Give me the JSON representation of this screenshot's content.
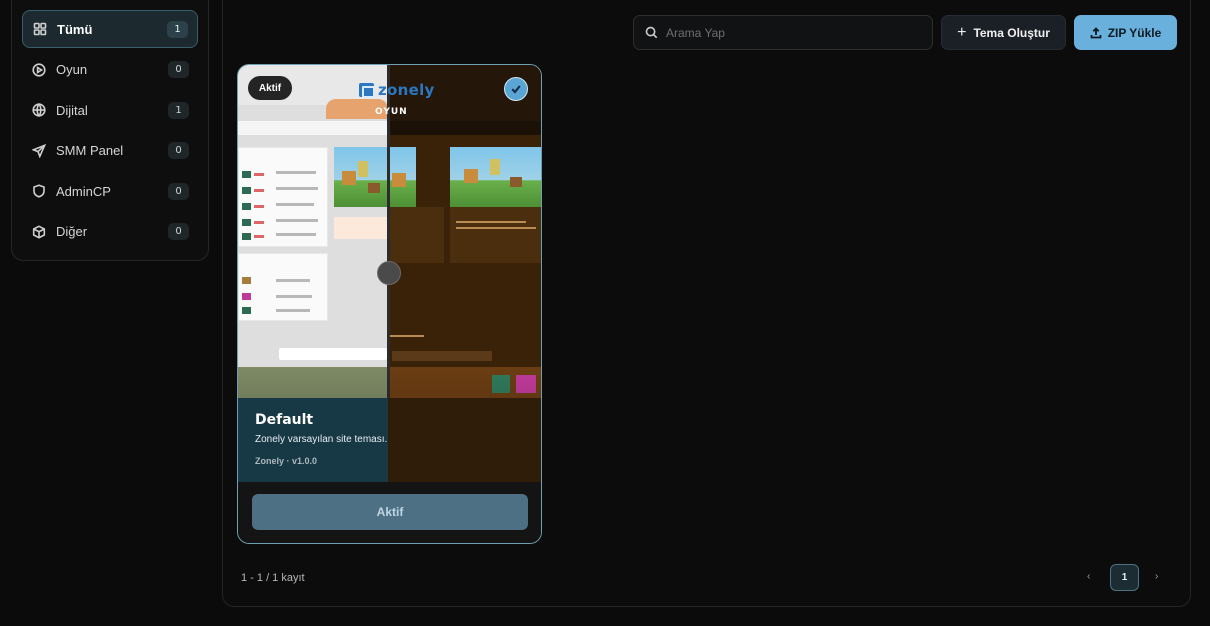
{
  "sidebar": {
    "items": [
      {
        "label": "Tümü",
        "count": "1",
        "icon": "grid-icon",
        "active": true
      },
      {
        "label": "Oyun",
        "count": "0",
        "icon": "play-circle-icon"
      },
      {
        "label": "Dijital",
        "count": "1",
        "icon": "globe-icon"
      },
      {
        "label": "SMM Panel",
        "count": "0",
        "icon": "send-icon"
      },
      {
        "label": "AdminCP",
        "count": "0",
        "icon": "shield-icon"
      },
      {
        "label": "Diğer",
        "count": "0",
        "icon": "cube-icon"
      }
    ]
  },
  "toolbar": {
    "search_placeholder": "Arama Yap",
    "create_label": "Tema Oluştur",
    "zip_label": "ZIP Yükle"
  },
  "theme_card": {
    "badge": "Aktif",
    "brand": "zonely",
    "preview_heading": "OYUN",
    "title": "Default",
    "description": "Zonely varsayılan site teması.",
    "meta": "Zonely · v1.0.0",
    "button_label": "Aktif",
    "selected": true
  },
  "pagination": {
    "records": "1 - 1 / 1 kayıt",
    "prev": "‹",
    "current": "1",
    "next": "›"
  },
  "colors": {
    "accent": "#6ab0dc",
    "active_border": "#3a5d68",
    "card_border": "#6f9fb2"
  }
}
